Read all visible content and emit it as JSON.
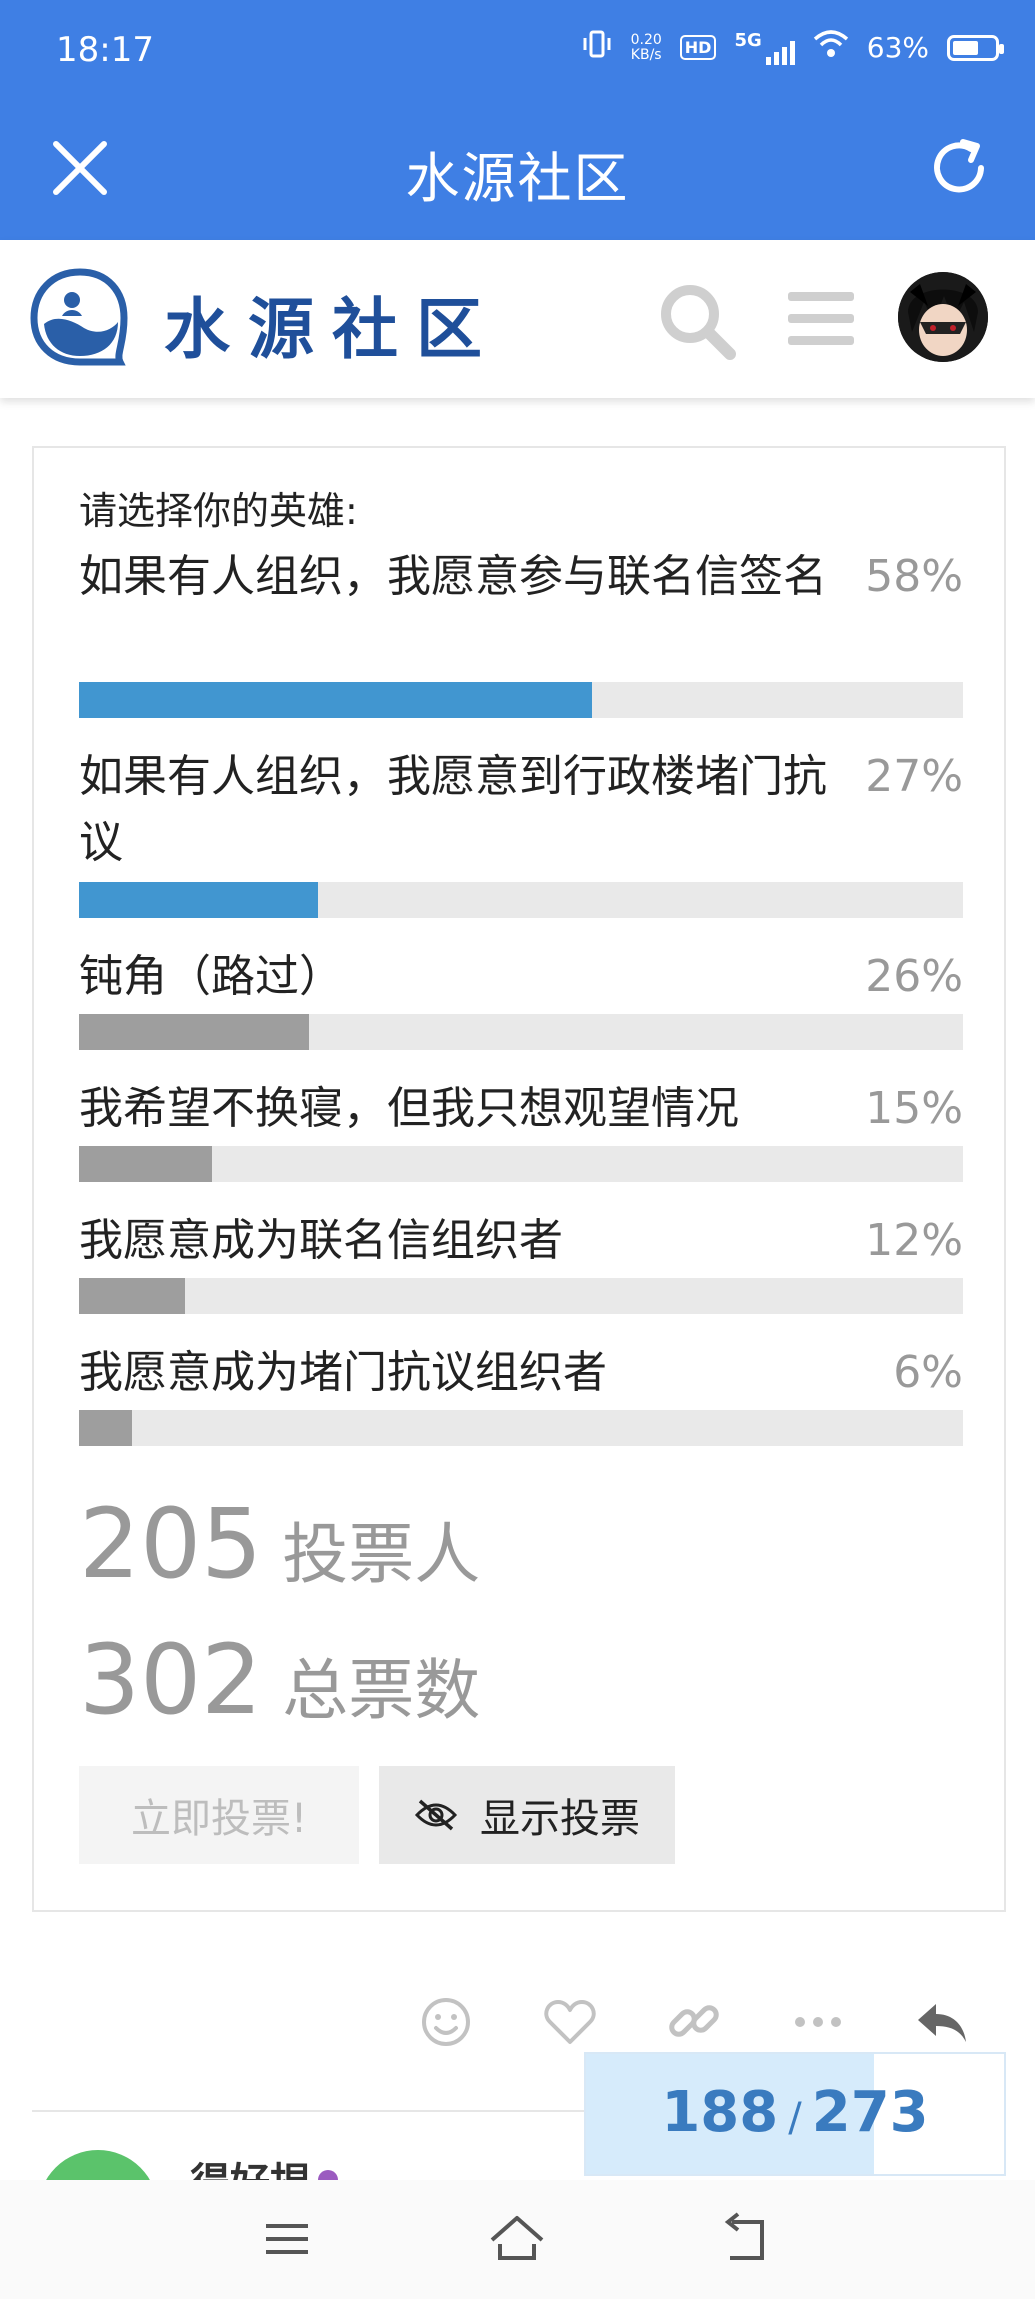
{
  "status_bar": {
    "time": "18:17",
    "net_speed": "0.20",
    "net_unit": "KB/s",
    "hd": "HD",
    "network": "5G",
    "battery": "63%",
    "battery_level": 0.63
  },
  "app_bar": {
    "title": "水源社区",
    "close_icon": "close-icon",
    "refresh_icon": "refresh-icon"
  },
  "site_header": {
    "logo_text": "水源社区",
    "search_icon": "search-icon",
    "menu_icon": "hamburger-menu-icon"
  },
  "poll": {
    "title": "请选择你的英雄:",
    "options": [
      {
        "label": "如果有人组织，我愿意参与联名信签名",
        "pct_text": "58%",
        "pct": 58,
        "color": "#4196d0"
      },
      {
        "label": "如果有人组织，我愿意到行政楼堵门抗议",
        "pct_text": "27%",
        "pct": 27,
        "color": "#4196d0"
      },
      {
        "label": "钝角（路过）",
        "pct_text": "26%",
        "pct": 26,
        "color": "#9e9e9e"
      },
      {
        "label": "我希望不换寝，但我只想观望情况",
        "pct_text": "15%",
        "pct": 15,
        "color": "#9e9e9e"
      },
      {
        "label": "我愿意成为联名信组织者",
        "pct_text": "12%",
        "pct": 12,
        "color": "#9e9e9e"
      },
      {
        "label": "我愿意成为堵门抗议组织者",
        "pct_text": "6%",
        "pct": 6,
        "color": "#9e9e9e"
      }
    ],
    "voters_count": "205",
    "voters_label": "投票人",
    "votes_count": "302",
    "votes_label": "总票数",
    "vote_button": "立即投票!",
    "show_button": "显示投票"
  },
  "post_actions": {
    "emoji_icon": "smile-icon",
    "like_icon": "heart-icon",
    "link_icon": "link-icon",
    "more_icon": "more-icon",
    "reply_icon": "reply-icon"
  },
  "progress": {
    "current": "188",
    "separator": "/",
    "total": "273",
    "fraction": 0.688
  },
  "next_post": {
    "username": "得好捏"
  }
}
